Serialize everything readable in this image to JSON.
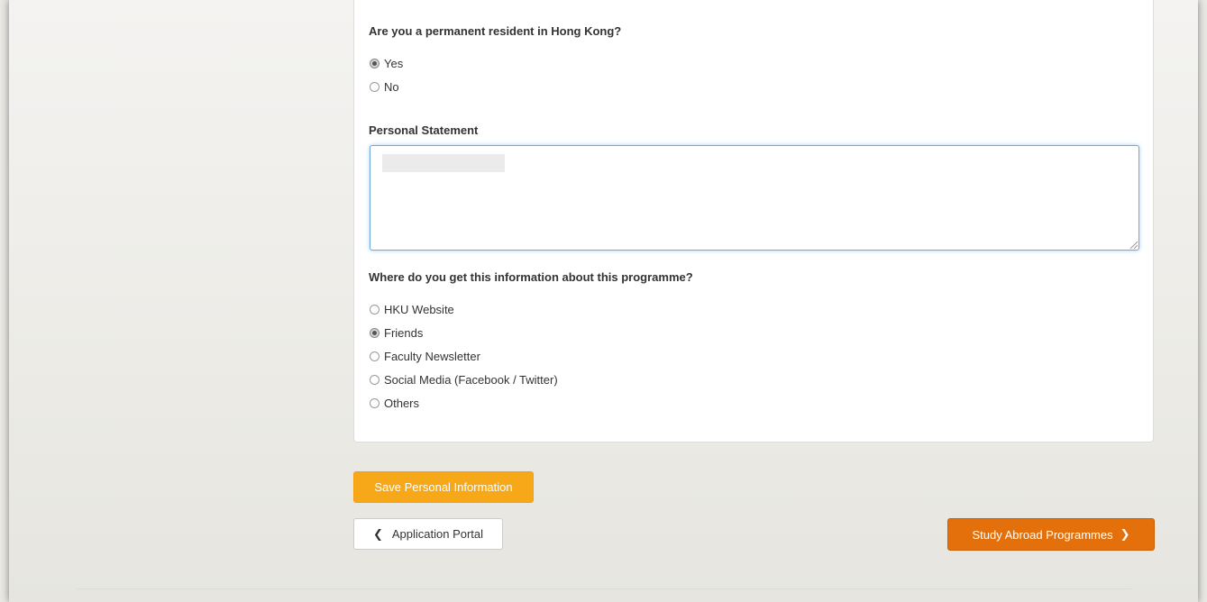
{
  "form": {
    "residency": {
      "question": "Are you a permanent resident in Hong Kong?",
      "options": [
        {
          "label": "Yes",
          "checked": true
        },
        {
          "label": "No",
          "checked": false
        }
      ]
    },
    "personal_statement": {
      "label": "Personal Statement",
      "value": ""
    },
    "source": {
      "question": "Where do you get this information about this programme?",
      "options": [
        {
          "label": "HKU Website",
          "checked": false
        },
        {
          "label": "Friends",
          "checked": true
        },
        {
          "label": "Faculty Newsletter",
          "checked": false
        },
        {
          "label": "Social Media (Facebook / Twitter)",
          "checked": false
        },
        {
          "label": "Others",
          "checked": false
        }
      ]
    }
  },
  "actions": {
    "save_label": "Save Personal Information",
    "back_label": "Application Portal",
    "next_label": "Study Abroad Programmes"
  },
  "colors": {
    "save_button": "#f7a819",
    "next_button": "#e4700c",
    "focus_border": "#6fa8dc"
  },
  "icons": {
    "back": "chevron-left-icon",
    "next": "chevron-right-icon"
  }
}
